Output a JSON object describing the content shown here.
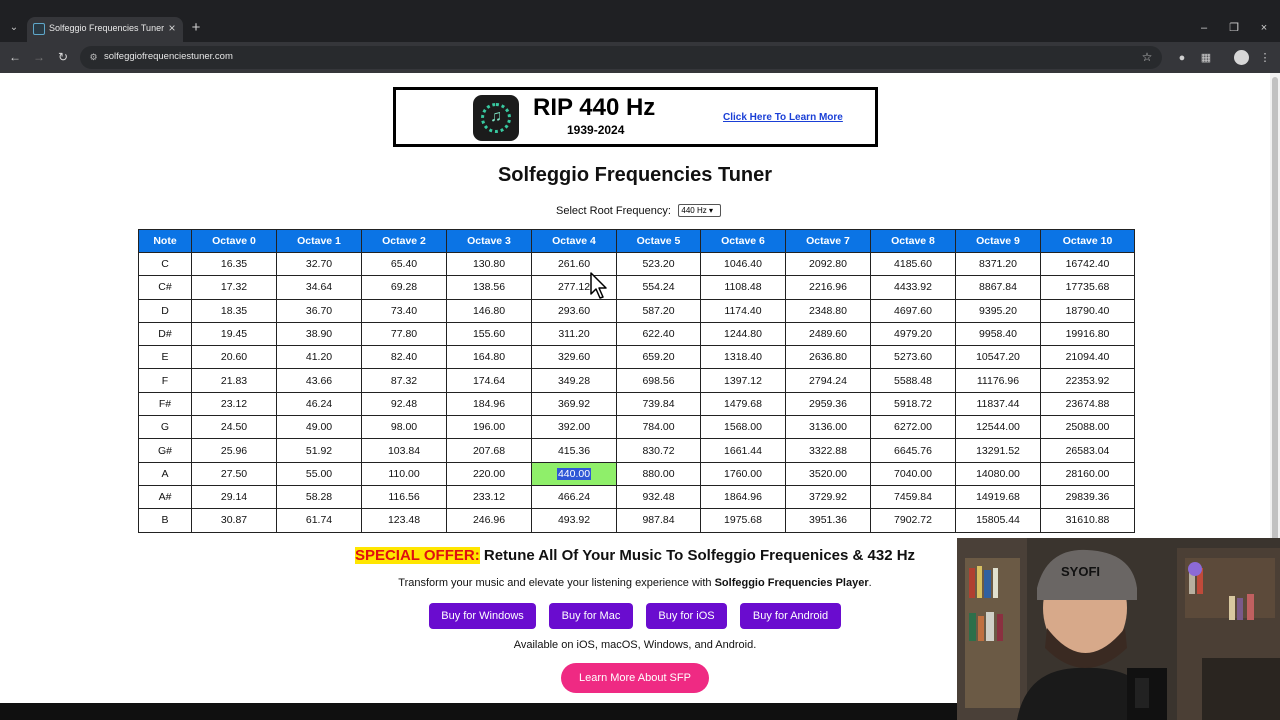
{
  "browser": {
    "tab_title": "Solfeggio Frequencies Tuner",
    "url": "solfeggiofrequenciestuner.com"
  },
  "banner": {
    "title": "RIP 440 Hz",
    "years": "1939-2024",
    "link": "Click Here To Learn More"
  },
  "page": {
    "title": "Solfeggio Frequencies Tuner",
    "root_label": "Select Root Frequency:",
    "root_value": "440 Hz"
  },
  "table": {
    "headers": [
      "Note",
      "Octave 0",
      "Octave 1",
      "Octave 2",
      "Octave 3",
      "Octave 4",
      "Octave 5",
      "Octave 6",
      "Octave 7",
      "Octave 8",
      "Octave 9",
      "Octave 10"
    ],
    "rows": [
      [
        "C",
        "16.35",
        "32.70",
        "65.40",
        "130.80",
        "261.60",
        "523.20",
        "1046.40",
        "2092.80",
        "4185.60",
        "8371.20",
        "16742.40"
      ],
      [
        "C#",
        "17.32",
        "34.64",
        "69.28",
        "138.56",
        "277.12",
        "554.24",
        "1108.48",
        "2216.96",
        "4433.92",
        "8867.84",
        "17735.68"
      ],
      [
        "D",
        "18.35",
        "36.70",
        "73.40",
        "146.80",
        "293.60",
        "587.20",
        "1174.40",
        "2348.80",
        "4697.60",
        "9395.20",
        "18790.40"
      ],
      [
        "D#",
        "19.45",
        "38.90",
        "77.80",
        "155.60",
        "311.20",
        "622.40",
        "1244.80",
        "2489.60",
        "4979.20",
        "9958.40",
        "19916.80"
      ],
      [
        "E",
        "20.60",
        "41.20",
        "82.40",
        "164.80",
        "329.60",
        "659.20",
        "1318.40",
        "2636.80",
        "5273.60",
        "10547.20",
        "21094.40"
      ],
      [
        "F",
        "21.83",
        "43.66",
        "87.32",
        "174.64",
        "349.28",
        "698.56",
        "1397.12",
        "2794.24",
        "5588.48",
        "11176.96",
        "22353.92"
      ],
      [
        "F#",
        "23.12",
        "46.24",
        "92.48",
        "184.96",
        "369.92",
        "739.84",
        "1479.68",
        "2959.36",
        "5918.72",
        "11837.44",
        "23674.88"
      ],
      [
        "G",
        "24.50",
        "49.00",
        "98.00",
        "196.00",
        "392.00",
        "784.00",
        "1568.00",
        "3136.00",
        "6272.00",
        "12544.00",
        "25088.00"
      ],
      [
        "G#",
        "25.96",
        "51.92",
        "103.84",
        "207.68",
        "415.36",
        "830.72",
        "1661.44",
        "3322.88",
        "6645.76",
        "13291.52",
        "26583.04"
      ],
      [
        "A",
        "27.50",
        "55.00",
        "110.00",
        "220.00",
        "440.00",
        "880.00",
        "1760.00",
        "3520.00",
        "7040.00",
        "14080.00",
        "28160.00"
      ],
      [
        "A#",
        "29.14",
        "58.28",
        "116.56",
        "233.12",
        "466.24",
        "932.48",
        "1864.96",
        "3729.92",
        "7459.84",
        "14919.68",
        "29839.36"
      ],
      [
        "B",
        "30.87",
        "61.74",
        "123.48",
        "246.96",
        "493.92",
        "987.84",
        "1975.68",
        "3951.36",
        "7902.72",
        "15805.44",
        "31610.88"
      ]
    ],
    "highlight": {
      "row": 9,
      "col": 5
    },
    "header_color": "#0b74e5",
    "highlight_color": "#8fef6a"
  },
  "offer": {
    "tag": "SPECIAL OFFER:",
    "text": "Retune All Of Your Music To Solfeggio Frequenices & 432 Hz",
    "sub_prefix": "Transform your music and elevate your listening experience with ",
    "sub_bold": "Solfeggio Frequencies Player",
    "sub_suffix": ".",
    "buttons": [
      "Buy for Windows",
      "Buy for Mac",
      "Buy for iOS",
      "Buy for Android"
    ],
    "available": "Available on iOS, macOS, Windows, and Android.",
    "learn_more": "Learn More About SFP",
    "button_color": "#6a0ccf",
    "learn_color": "#ef2a83"
  },
  "webcam": {
    "cap_text": "SYOFI"
  }
}
